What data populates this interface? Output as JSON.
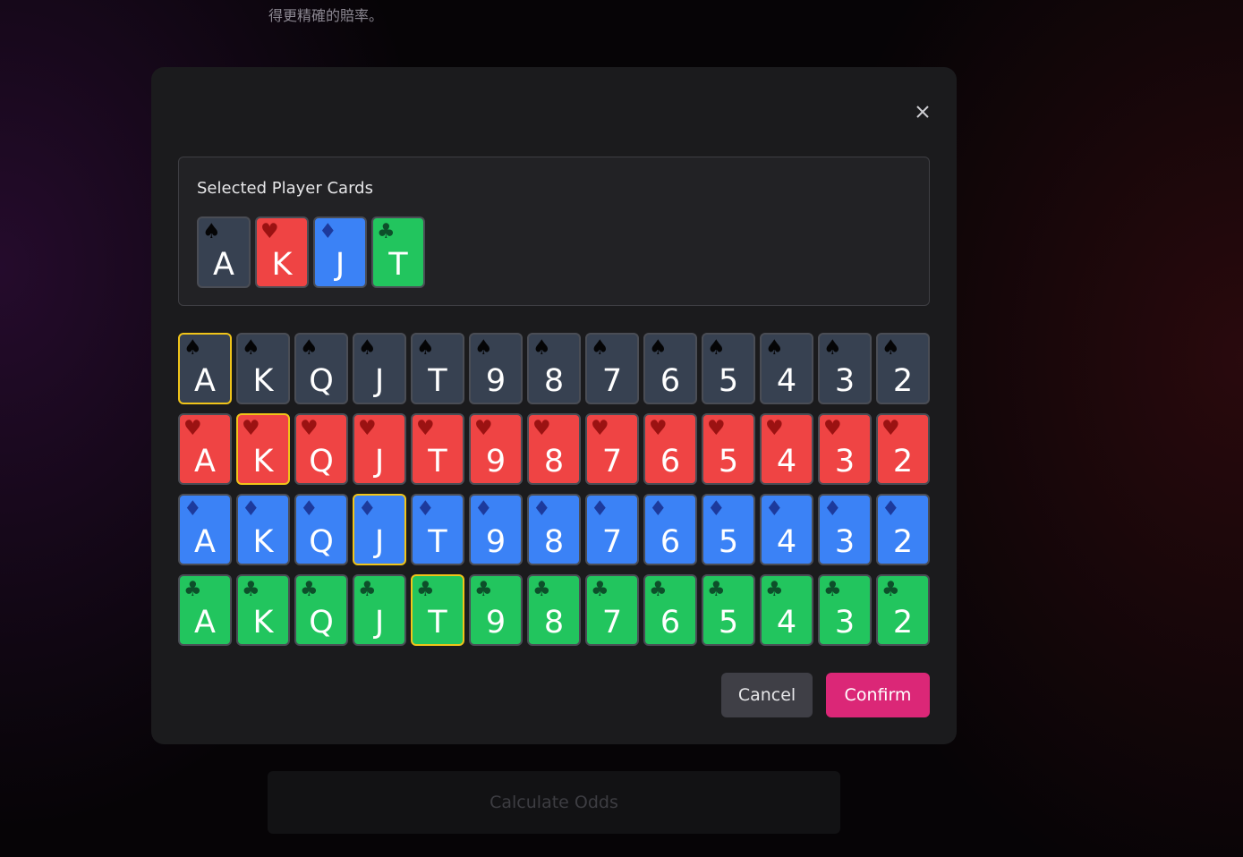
{
  "background": {
    "text_line": "得更精確的賠率。",
    "calculate_label": "Calculate Odds"
  },
  "modal": {
    "close_glyph": "×",
    "selected_title": "Selected Player Cards",
    "cancel_label": "Cancel",
    "confirm_label": "Confirm"
  },
  "selected_cards": [
    {
      "rank": "A",
      "suit": "s",
      "suit_glyph": "♠"
    },
    {
      "rank": "K",
      "suit": "h",
      "suit_glyph": "♥"
    },
    {
      "rank": "J",
      "suit": "d",
      "suit_glyph": "♦"
    },
    {
      "rank": "T",
      "suit": "c",
      "suit_glyph": "♣"
    }
  ],
  "deck": {
    "ranks": [
      "A",
      "K",
      "Q",
      "J",
      "T",
      "9",
      "8",
      "7",
      "6",
      "5",
      "4",
      "3",
      "2"
    ],
    "suits": [
      {
        "key": "s",
        "name": "spades",
        "glyph": "♠",
        "color": "#374151"
      },
      {
        "key": "h",
        "name": "hearts",
        "glyph": "♥",
        "color": "#ef4444"
      },
      {
        "key": "d",
        "name": "diamonds",
        "glyph": "♦",
        "color": "#3b82f6"
      },
      {
        "key": "c",
        "name": "clubs",
        "glyph": "♣",
        "color": "#22c55e"
      }
    ],
    "selected": [
      "As",
      "Kh",
      "Jd",
      "Tc"
    ]
  },
  "colors": {
    "accent": "#db2777",
    "selected_border": "#f0c419",
    "modal_bg": "#1b1b1d"
  }
}
